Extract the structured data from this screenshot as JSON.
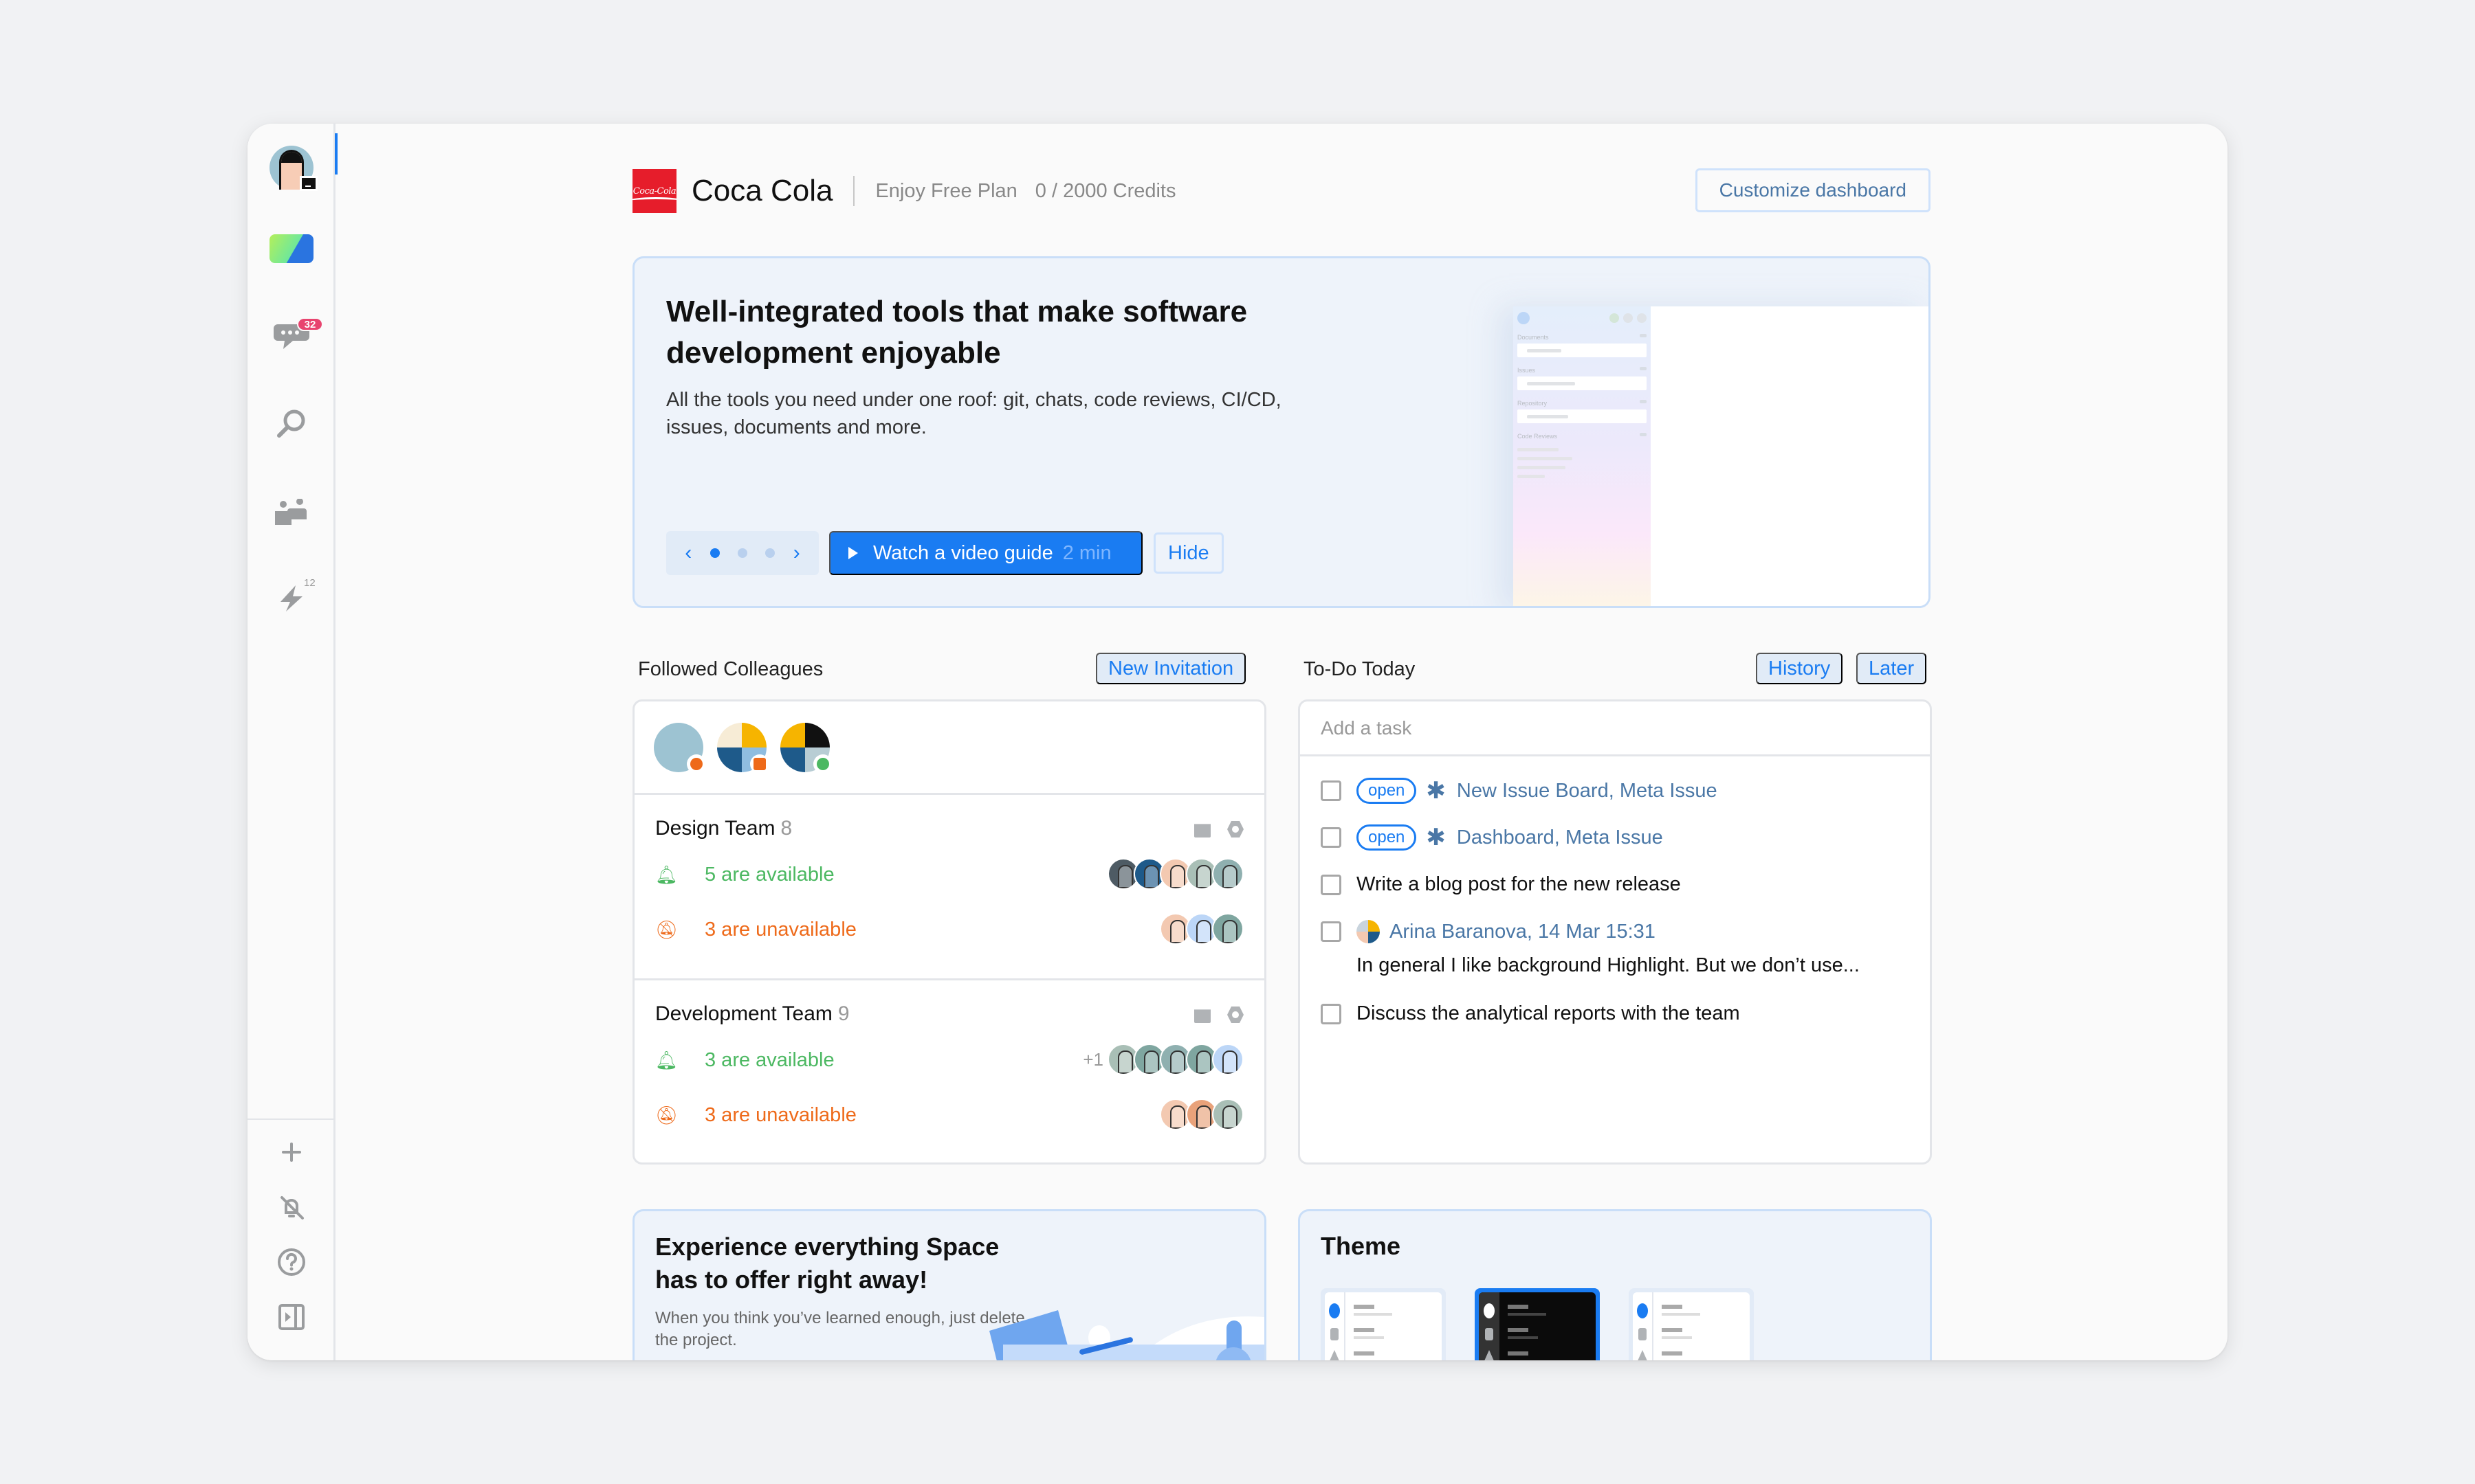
{
  "sidebar": {
    "profile": {
      "icon": "user-avatar-icon",
      "status": "laptop-status"
    },
    "items": [
      {
        "name": "space-logo",
        "icon": "space-logo-icon"
      },
      {
        "name": "chats",
        "icon": "chat-icon",
        "badge": "32"
      },
      {
        "name": "search",
        "icon": "search-icon"
      },
      {
        "name": "team-directory",
        "icon": "people-icon"
      },
      {
        "name": "automation",
        "icon": "lightning-icon",
        "count": "12"
      }
    ],
    "bottom_items": [
      {
        "name": "add",
        "icon": "plus-icon"
      },
      {
        "name": "notifications-muted",
        "icon": "bell-off-icon"
      },
      {
        "name": "help",
        "icon": "help-icon"
      },
      {
        "name": "toggle-panel",
        "icon": "panel-toggle-icon"
      }
    ]
  },
  "header": {
    "org_name": "Coca Cola",
    "logo_text": "Coca-Cola",
    "plan": "Enjoy Free Plan",
    "credits": "0 / 2000 Credits",
    "customize_label": "Customize dashboard"
  },
  "banner": {
    "title": "Well-integrated tools that make software development enjoyable",
    "description": "All the tools you need under one roof: git, chats, code reviews, CI/CD, issues, documents and more.",
    "pager": {
      "pages": 3,
      "current": 1
    },
    "watch_label": "Watch a video guide",
    "watch_duration": "2 min",
    "hide_label": "Hide",
    "preview_sections": [
      "Documents",
      "Issues",
      "Repository",
      "Code Reviews"
    ]
  },
  "colleagues": {
    "title": "Followed Colleagues",
    "invite_label": "New Invitation",
    "followed": [
      {
        "status": "away",
        "status_color": "#ee6a1a"
      },
      {
        "status": "busy",
        "status_color": "#ee6a1a"
      },
      {
        "status": "online",
        "status_color": "#4cb862"
      }
    ],
    "teams": [
      {
        "name": "Design Team",
        "count": "8",
        "available_label": "5 are available",
        "available_count": 5,
        "unavailable_label": "3 are unavailable",
        "unavailable_count": 3,
        "extra": ""
      },
      {
        "name": "Development Team",
        "count": "9",
        "available_label": "3 are available",
        "available_count": 5,
        "unavailable_label": "3 are unavailable",
        "unavailable_count": 3,
        "extra": "+1"
      }
    ]
  },
  "todo": {
    "title": "To-Do Today",
    "history_label": "History",
    "later_label": "Later",
    "add_placeholder": "Add a task",
    "items": [
      {
        "type": "issue",
        "status": "open",
        "text": "New Issue Board, Meta Issue"
      },
      {
        "type": "issue",
        "status": "open",
        "text": "Dashboard, Meta Issue"
      },
      {
        "type": "plain",
        "text": "Write a blog post for the new release"
      },
      {
        "type": "message",
        "author": "Arina Baranova, 14 Mar 15:31",
        "text": "In general I like background Highlight. But we don’t use..."
      },
      {
        "type": "plain",
        "text": "Discuss the analytical reports with the team"
      }
    ]
  },
  "experience": {
    "title": "Experience everything Space has to offer right away!",
    "description": "When you think you’ve learned enough, just delete the project."
  },
  "theme": {
    "title": "Theme",
    "options": [
      {
        "name": "light",
        "selected": false
      },
      {
        "name": "dark",
        "selected": true
      },
      {
        "name": "system",
        "selected": false
      }
    ]
  },
  "colors": {
    "accent": "#1a7cf2",
    "available": "#4cb862",
    "unavailable": "#ee6a1a",
    "badge": "#e8446f",
    "brand_red": "#e61d2b"
  }
}
